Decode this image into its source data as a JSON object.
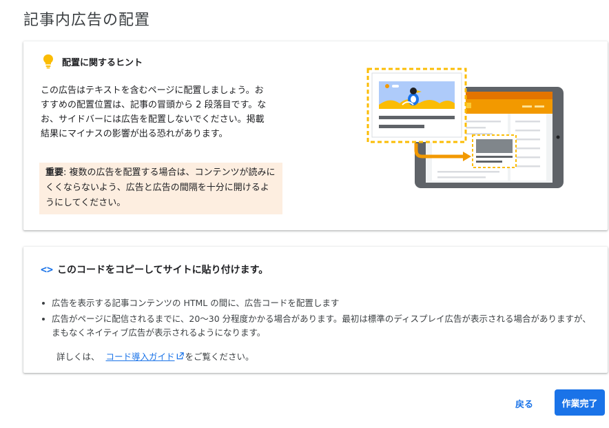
{
  "page": {
    "title": "記事内広告の配置"
  },
  "tips": {
    "title": "配置に関するヒント",
    "body": "この広告はテキストを含むページに配置しましょう。おすすめの配置位置は、記事の冒頭から 2 段落目です。なお、サイドバーには広告を配置しないでください。掲載結果にマイナスの影響が出る恐れがあります。",
    "note_bold": "重要",
    "note_text": ": 複数の広告を配置する場合は、コンテンツが読みにくくならないよう、広告と広告の間隔を十分に開けるようにしてください。"
  },
  "code": {
    "icon": "code-icon",
    "title": "このコードをコピーしてサイトに貼り付けます。",
    "bullets": [
      "広告を表示する記事コンテンツの HTML の間に、広告コードを配置します",
      "広告がページに配信されるまでに、20〜30 分程度かかる場合があります。最初は標準のディスプレイ広告が表示される場合がありますが、まもなくネイティブ広告が表示されるようになります。"
    ],
    "detail_prefix": "詳しくは、",
    "detail_link": "コード導入ガイド",
    "detail_suffix": "をご覧ください。"
  },
  "buttons": {
    "back": "戻る",
    "done": "作業完了"
  },
  "colors": {
    "accent": "#1a73e8",
    "note_bg": "#fdeee0",
    "highlight": "#fbbc04",
    "orange": "#f29900"
  }
}
